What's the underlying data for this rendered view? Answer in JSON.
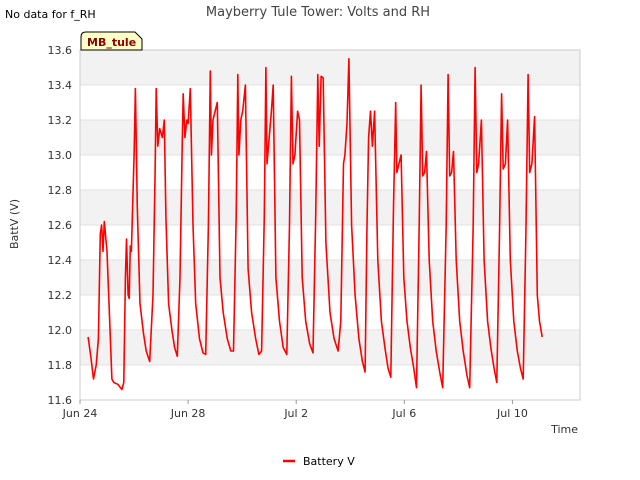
{
  "note": "No data for f_RH",
  "station_tag": "MB_tule",
  "chart_data": {
    "type": "line",
    "title": "Mayberry Tule Tower: Volts and RH",
    "xlabel": "Time",
    "ylabel": "BattV (V)",
    "ylim": [
      11.6,
      13.6
    ],
    "xlim": [
      "2024-06-24",
      "2024-07-12T12:00"
    ],
    "x_ticks": [
      "Jun 24",
      "Jun 28",
      "Jul 2",
      "Jul 6",
      "Jul 10"
    ],
    "y_ticks": [
      "11.6",
      "11.8",
      "12.0",
      "12.2",
      "12.4",
      "12.6",
      "12.8",
      "13.0",
      "13.2",
      "13.4",
      "13.6"
    ],
    "grid": true,
    "legend_position": "bottom-center",
    "series": [
      {
        "name": "Battery V",
        "color": "#ff0000",
        "x_unit": "days since Jun 24",
        "points": [
          [
            0.3,
            11.96
          ],
          [
            0.4,
            11.85
          ],
          [
            0.5,
            11.72
          ],
          [
            0.6,
            11.8
          ],
          [
            0.68,
            11.95
          ],
          [
            0.75,
            12.55
          ],
          [
            0.8,
            12.6
          ],
          [
            0.85,
            12.45
          ],
          [
            0.9,
            12.62
          ],
          [
            1.0,
            12.45
          ],
          [
            1.1,
            12.05
          ],
          [
            1.18,
            11.72
          ],
          [
            1.25,
            11.7
          ],
          [
            1.4,
            11.69
          ],
          [
            1.55,
            11.66
          ],
          [
            1.62,
            11.7
          ],
          [
            1.68,
            12.3
          ],
          [
            1.72,
            12.52
          ],
          [
            1.78,
            12.2
          ],
          [
            1.82,
            12.18
          ],
          [
            1.86,
            12.48
          ],
          [
            1.9,
            12.45
          ],
          [
            1.95,
            12.72
          ],
          [
            2.0,
            13.0
          ],
          [
            2.05,
            13.38
          ],
          [
            2.12,
            12.7
          ],
          [
            2.22,
            12.15
          ],
          [
            2.35,
            11.98
          ],
          [
            2.45,
            11.88
          ],
          [
            2.58,
            11.82
          ],
          [
            2.7,
            12.2
          ],
          [
            2.78,
            12.9
          ],
          [
            2.82,
            13.38
          ],
          [
            2.88,
            13.05
          ],
          [
            2.95,
            13.15
          ],
          [
            3.05,
            13.1
          ],
          [
            3.12,
            13.2
          ],
          [
            3.18,
            12.65
          ],
          [
            3.28,
            12.15
          ],
          [
            3.4,
            12.0
          ],
          [
            3.5,
            11.9
          ],
          [
            3.6,
            11.85
          ],
          [
            3.7,
            12.3
          ],
          [
            3.78,
            13.05
          ],
          [
            3.82,
            13.35
          ],
          [
            3.88,
            13.1
          ],
          [
            3.95,
            13.2
          ],
          [
            4.0,
            13.18
          ],
          [
            4.08,
            13.38
          ],
          [
            4.18,
            12.6
          ],
          [
            4.28,
            12.15
          ],
          [
            4.42,
            11.95
          ],
          [
            4.55,
            11.87
          ],
          [
            4.65,
            11.86
          ],
          [
            4.75,
            12.6
          ],
          [
            4.82,
            13.48
          ],
          [
            4.86,
            13.0
          ],
          [
            4.92,
            13.2
          ],
          [
            5.0,
            13.25
          ],
          [
            5.08,
            13.3
          ],
          [
            5.18,
            12.3
          ],
          [
            5.3,
            12.1
          ],
          [
            5.45,
            11.95
          ],
          [
            5.58,
            11.88
          ],
          [
            5.68,
            11.88
          ],
          [
            5.78,
            12.65
          ],
          [
            5.84,
            13.46
          ],
          [
            5.88,
            13.0
          ],
          [
            5.95,
            13.2
          ],
          [
            6.02,
            13.25
          ],
          [
            6.12,
            13.4
          ],
          [
            6.22,
            12.35
          ],
          [
            6.35,
            12.1
          ],
          [
            6.5,
            11.95
          ],
          [
            6.62,
            11.86
          ],
          [
            6.72,
            11.88
          ],
          [
            6.82,
            12.65
          ],
          [
            6.88,
            13.5
          ],
          [
            6.92,
            12.95
          ],
          [
            7.0,
            13.1
          ],
          [
            7.08,
            13.25
          ],
          [
            7.15,
            13.4
          ],
          [
            7.25,
            12.3
          ],
          [
            7.38,
            12.05
          ],
          [
            7.52,
            11.9
          ],
          [
            7.65,
            11.86
          ],
          [
            7.75,
            12.6
          ],
          [
            7.82,
            13.45
          ],
          [
            7.88,
            12.95
          ],
          [
            7.95,
            13.0
          ],
          [
            8.05,
            13.25
          ],
          [
            8.12,
            13.2
          ],
          [
            8.22,
            12.3
          ],
          [
            8.35,
            12.05
          ],
          [
            8.5,
            11.92
          ],
          [
            8.62,
            11.87
          ],
          [
            8.72,
            12.65
          ],
          [
            8.8,
            13.46
          ],
          [
            8.85,
            13.05
          ],
          [
            8.92,
            13.45
          ],
          [
            9.0,
            13.44
          ],
          [
            9.1,
            12.5
          ],
          [
            9.25,
            12.1
          ],
          [
            9.4,
            11.95
          ],
          [
            9.55,
            11.88
          ],
          [
            9.65,
            12.05
          ],
          [
            9.75,
            12.95
          ],
          [
            9.8,
            13.0
          ],
          [
            9.88,
            13.18
          ],
          [
            9.95,
            13.55
          ],
          [
            10.05,
            12.6
          ],
          [
            10.18,
            12.2
          ],
          [
            10.32,
            11.95
          ],
          [
            10.45,
            11.82
          ],
          [
            10.55,
            11.76
          ],
          [
            10.62,
            12.6
          ],
          [
            10.68,
            13.1
          ],
          [
            10.75,
            13.25
          ],
          [
            10.82,
            13.05
          ],
          [
            10.9,
            13.25
          ],
          [
            11.02,
            12.4
          ],
          [
            11.15,
            12.05
          ],
          [
            11.28,
            11.9
          ],
          [
            11.4,
            11.78
          ],
          [
            11.5,
            11.73
          ],
          [
            11.6,
            12.7
          ],
          [
            11.68,
            13.3
          ],
          [
            11.72,
            12.9
          ],
          [
            11.8,
            12.95
          ],
          [
            11.88,
            13.0
          ],
          [
            11.98,
            12.3
          ],
          [
            12.1,
            12.05
          ],
          [
            12.22,
            11.9
          ],
          [
            12.35,
            11.78
          ],
          [
            12.45,
            11.67
          ],
          [
            12.55,
            12.6
          ],
          [
            12.62,
            13.4
          ],
          [
            12.68,
            12.88
          ],
          [
            12.75,
            12.9
          ],
          [
            12.82,
            13.02
          ],
          [
            12.92,
            12.4
          ],
          [
            13.05,
            12.05
          ],
          [
            13.18,
            11.88
          ],
          [
            13.32,
            11.75
          ],
          [
            13.42,
            11.67
          ],
          [
            13.55,
            12.6
          ],
          [
            13.62,
            13.46
          ],
          [
            13.68,
            12.88
          ],
          [
            13.75,
            12.9
          ],
          [
            13.82,
            13.02
          ],
          [
            13.92,
            12.4
          ],
          [
            14.05,
            12.05
          ],
          [
            14.18,
            11.88
          ],
          [
            14.32,
            11.74
          ],
          [
            14.42,
            11.67
          ],
          [
            14.55,
            12.6
          ],
          [
            14.62,
            13.5
          ],
          [
            14.68,
            12.9
          ],
          [
            14.75,
            12.95
          ],
          [
            14.85,
            13.2
          ],
          [
            14.95,
            12.4
          ],
          [
            15.08,
            12.05
          ],
          [
            15.2,
            11.9
          ],
          [
            15.32,
            11.78
          ],
          [
            15.42,
            11.7
          ],
          [
            15.52,
            12.55
          ],
          [
            15.6,
            13.35
          ],
          [
            15.66,
            12.92
          ],
          [
            15.74,
            12.95
          ],
          [
            15.82,
            13.2
          ],
          [
            15.92,
            12.4
          ],
          [
            16.05,
            12.05
          ],
          [
            16.18,
            11.88
          ],
          [
            16.3,
            11.78
          ],
          [
            16.4,
            11.72
          ],
          [
            16.5,
            12.55
          ],
          [
            16.58,
            13.46
          ],
          [
            16.64,
            12.9
          ],
          [
            16.72,
            12.95
          ],
          [
            16.82,
            13.22
          ],
          [
            16.92,
            12.2
          ],
          [
            17.0,
            12.05
          ],
          [
            17.1,
            11.96
          ]
        ]
      }
    ]
  }
}
